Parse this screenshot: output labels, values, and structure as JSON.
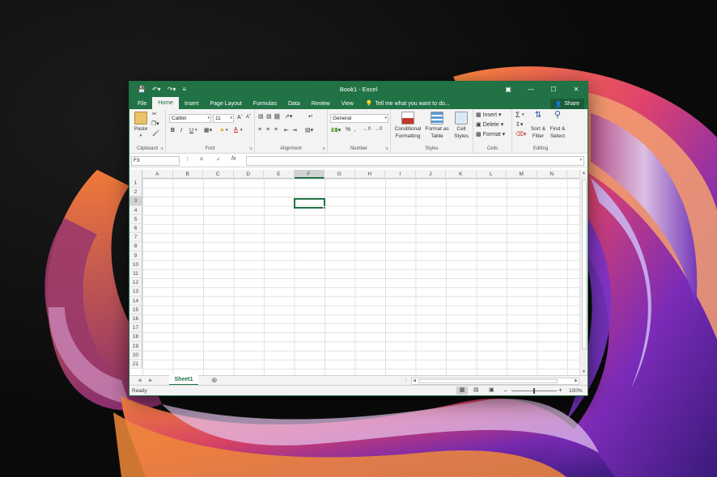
{
  "window": {
    "title": "Book1 - Excel",
    "controls": [
      "restore-ribbon-icon",
      "minimize-icon",
      "maximize-icon",
      "close-icon"
    ]
  },
  "qat": {
    "save_icon": "save-icon",
    "undo_icon": "undo-icon",
    "redo_icon": "redo-icon"
  },
  "tabs": [
    {
      "label": "File"
    },
    {
      "label": "Home"
    },
    {
      "label": "Insert"
    },
    {
      "label": "Page Layout"
    },
    {
      "label": "Formulas"
    },
    {
      "label": "Data"
    },
    {
      "label": "Review"
    },
    {
      "label": "View"
    }
  ],
  "active_tab": "Home",
  "tell_me": "Tell me what you want to do...",
  "share": "Share",
  "ribbon": {
    "clipboard": {
      "label": "Clipboard",
      "paste": "Paste"
    },
    "font": {
      "label": "Font",
      "name": "Calibri",
      "size": "11",
      "bold": "B",
      "italic": "I",
      "underline": "U"
    },
    "alignment": {
      "label": "Alignment"
    },
    "number": {
      "label": "Number",
      "format": "General",
      "percent": "%"
    },
    "styles": {
      "label": "Styles",
      "conditional_l1": "Conditional",
      "conditional_l2": "Formatting",
      "format_table_l1": "Format as",
      "format_table_l2": "Table",
      "cell_styles_l1": "Cell",
      "cell_styles_l2": "Styles"
    },
    "cells": {
      "label": "Cells",
      "insert": "Insert",
      "delete": "Delete",
      "format": "Format"
    },
    "editing": {
      "label": "Editing",
      "sort_l1": "Sort &",
      "sort_l2": "Filter",
      "find_l1": "Find &",
      "find_l2": "Select"
    }
  },
  "formula_bar": {
    "name_box": "F3",
    "fx": "fx",
    "value": ""
  },
  "columns": [
    "A",
    "B",
    "C",
    "D",
    "E",
    "F",
    "G",
    "H",
    "I",
    "J",
    "K",
    "L",
    "M",
    "N"
  ],
  "rows": [
    "1",
    "2",
    "3",
    "4",
    "5",
    "6",
    "7",
    "8",
    "9",
    "10",
    "11",
    "12",
    "13",
    "14",
    "15",
    "16",
    "17",
    "18",
    "19",
    "20",
    "21"
  ],
  "selection": {
    "cell": "F3",
    "column": "F",
    "row": "3"
  },
  "sheets": [
    {
      "label": "Sheet1",
      "active": true
    }
  ],
  "status": {
    "state": "Ready",
    "zoom": "100%"
  },
  "colors": {
    "excel_green": "#217346",
    "ribbon_bg": "#f3f3f3"
  }
}
